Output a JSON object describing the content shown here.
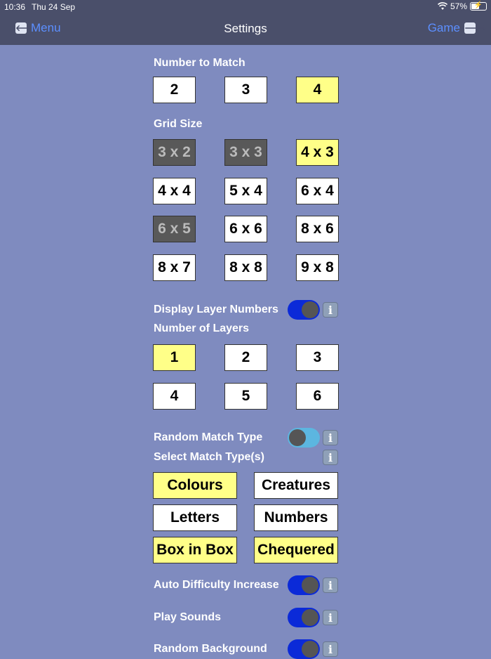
{
  "status": {
    "time": "10:36",
    "date": "Thu 24 Sep",
    "battery": "57%"
  },
  "nav": {
    "back_label": "Menu",
    "title": "Settings",
    "forward_label": "Game"
  },
  "number_to_match": {
    "label": "Number to Match",
    "options": [
      "2",
      "3",
      "4"
    ],
    "selected": "4"
  },
  "grid_size": {
    "label": "Grid Size",
    "options": [
      "3 x 2",
      "3 x 3",
      "4 x 3",
      "4 x 4",
      "5 x 4",
      "6 x 4",
      "6 x 5",
      "6 x 6",
      "8 x 6",
      "8 x 7",
      "8 x 8",
      "9 x 8"
    ],
    "selected": "4 x 3",
    "disabled": [
      "3 x 2",
      "3 x 3",
      "6 x 5"
    ]
  },
  "display_layer_numbers": {
    "label": "Display Layer Numbers",
    "on": true
  },
  "number_of_layers": {
    "label": "Number of Layers",
    "options": [
      "1",
      "2",
      "3",
      "4",
      "5",
      "6"
    ],
    "selected": "1"
  },
  "random_match_type": {
    "label": "Random Match Type",
    "on": false
  },
  "select_match_types": {
    "label": "Select Match Type(s)",
    "options": [
      "Colours",
      "Creatures",
      "Letters",
      "Numbers",
      "Box in Box",
      "Chequered"
    ],
    "selected": [
      "Colours",
      "Box in Box",
      "Chequered"
    ]
  },
  "auto_difficulty_increase": {
    "label": "Auto Difficulty Increase",
    "on": true
  },
  "play_sounds": {
    "label": "Play Sounds",
    "on": true
  },
  "random_background": {
    "label": "Random Background",
    "on": true
  },
  "info_icon_glyph": "i",
  "colors": {
    "background": "#7f8bbf",
    "bar": "#4a4f6a",
    "selected": "#ffff88",
    "toggle_on": "#0b2ad8",
    "toggle_off": "#5cb6e0",
    "link": "#5c8fff"
  }
}
